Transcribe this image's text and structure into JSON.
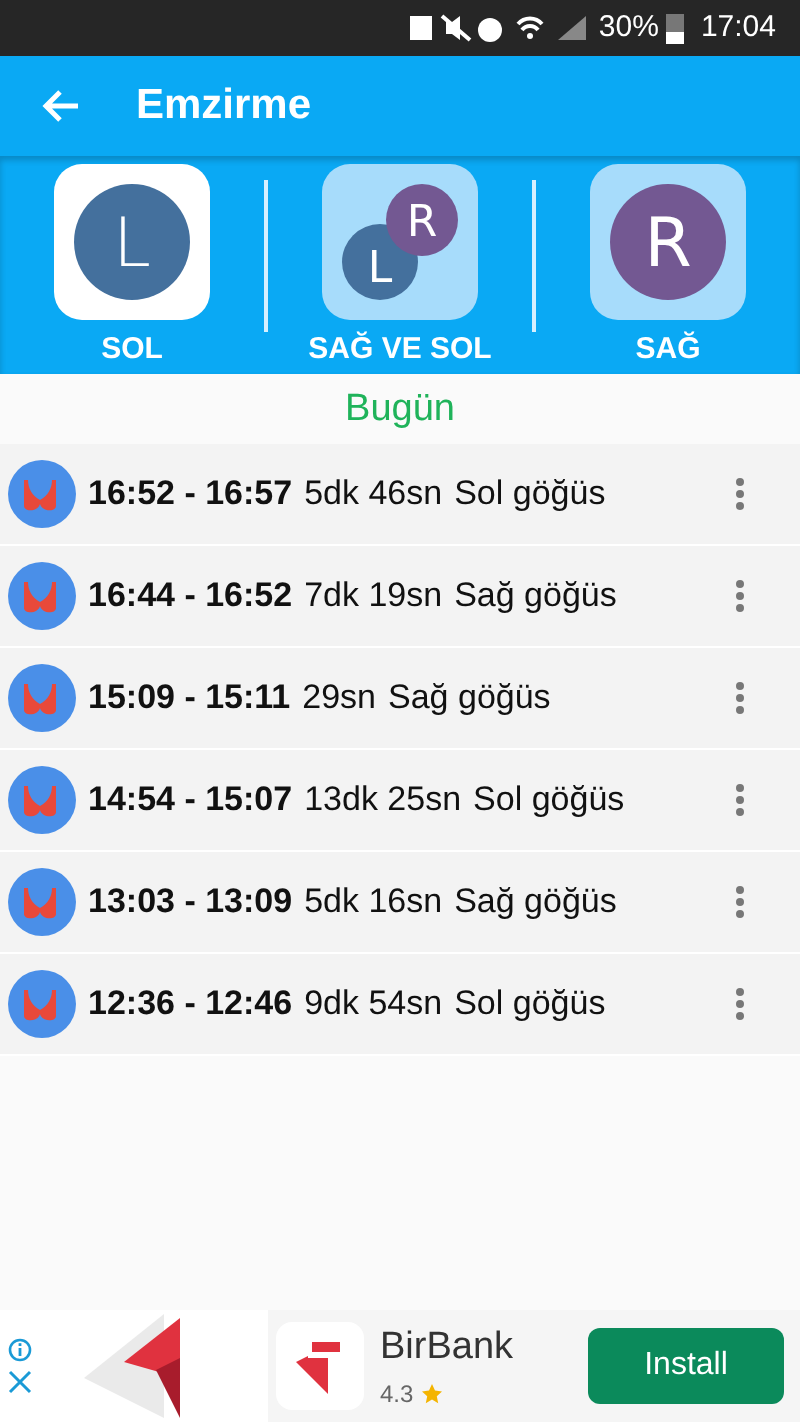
{
  "status_bar": {
    "battery": "30%",
    "time": "17:04"
  },
  "toolbar": {
    "title": "Emzirme"
  },
  "options": [
    {
      "kind": "left",
      "label": "SOL",
      "letter": "L",
      "selected": true
    },
    {
      "kind": "both",
      "label": "SAĞ VE SOL",
      "letters": [
        "R",
        "L"
      ],
      "selected": false
    },
    {
      "kind": "right",
      "label": "SAĞ",
      "letter": "R",
      "selected": false
    }
  ],
  "section": {
    "title": "Bugün"
  },
  "sessions": [
    {
      "time": "16:52 - 16:57",
      "duration": "5dk 46sn",
      "side": "Sol göğüs"
    },
    {
      "time": "16:44 - 16:52",
      "duration": "7dk 19sn",
      "side": "Sağ göğüs"
    },
    {
      "time": "15:09 - 15:11",
      "duration": "29sn",
      "side": "Sağ göğüs"
    },
    {
      "time": "14:54 - 15:07",
      "duration": "13dk 25sn",
      "side": "Sol göğüs"
    },
    {
      "time": "13:03 - 13:09",
      "duration": "5dk 16sn",
      "side": "Sağ göğüs"
    },
    {
      "time": "12:36 - 12:46",
      "duration": "9dk 54sn",
      "side": "Sol göğüs"
    }
  ],
  "ad": {
    "app_name": "BirBank",
    "rating": "4.3",
    "button": "Install"
  }
}
